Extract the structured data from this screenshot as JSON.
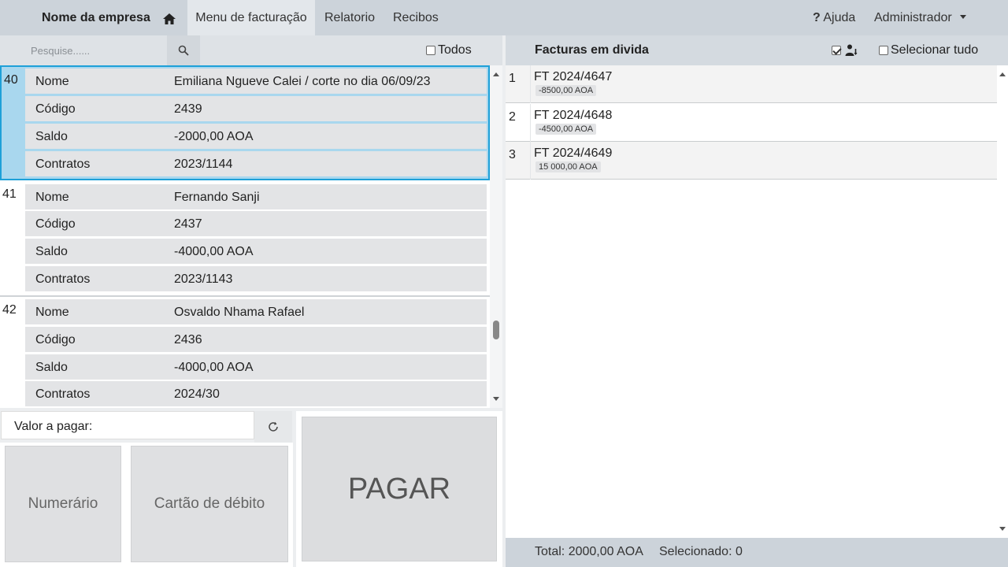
{
  "header": {
    "brand": "Nome da empresa",
    "nav": [
      "Menu de facturação",
      "Relatorio",
      "Recibos"
    ],
    "help": "Ajuda",
    "user": "Administrador"
  },
  "left": {
    "search_placeholder": "Pesquise......",
    "all_label": "Todos",
    "clients": [
      {
        "num": "40",
        "fields": [
          {
            "label": "Nome",
            "value": "Emiliana Ngueve Calei / corte no dia 06/09/23"
          },
          {
            "label": "Código",
            "value": "2439"
          },
          {
            "label": "Saldo",
            "value": "-2000,00 AOA"
          },
          {
            "label": "Contratos",
            "value": "2023/1144"
          }
        ]
      },
      {
        "num": "41",
        "fields": [
          {
            "label": "Nome",
            "value": "Fernando Sanji"
          },
          {
            "label": "Código",
            "value": "2437"
          },
          {
            "label": "Saldo",
            "value": "-4000,00 AOA"
          },
          {
            "label": "Contratos",
            "value": "2023/1143"
          }
        ]
      },
      {
        "num": "42",
        "fields": [
          {
            "label": "Nome",
            "value": "Osvaldo Nhama Rafael"
          },
          {
            "label": "Código",
            "value": "2436"
          },
          {
            "label": "Saldo",
            "value": "-4000,00 AOA"
          },
          {
            "label": "Contratos",
            "value": "2024/30"
          }
        ]
      }
    ]
  },
  "payment": {
    "amount_label": "Valor a pagar:",
    "cash": "Numerário",
    "card": "Cartão de débito",
    "pay": "PAGAR"
  },
  "right": {
    "title": "Facturas em divida",
    "select_all": "Selecionar tudo",
    "invoices": [
      {
        "num": "1",
        "title": "FT 2024/4647",
        "amount": "-8500,00 AOA"
      },
      {
        "num": "2",
        "title": "FT 2024/4648",
        "amount": "-4500,00 AOA"
      },
      {
        "num": "3",
        "title": "FT 2024/4649",
        "amount": "15 000,00 AOA"
      }
    ],
    "total": "Total: 2000,00 AOA",
    "selected": "Selecionado: 0"
  },
  "colors": {
    "selected_bg": "#a9d7ee",
    "selected_border": "#1ea0d8",
    "topbar": "#ccd3da"
  }
}
